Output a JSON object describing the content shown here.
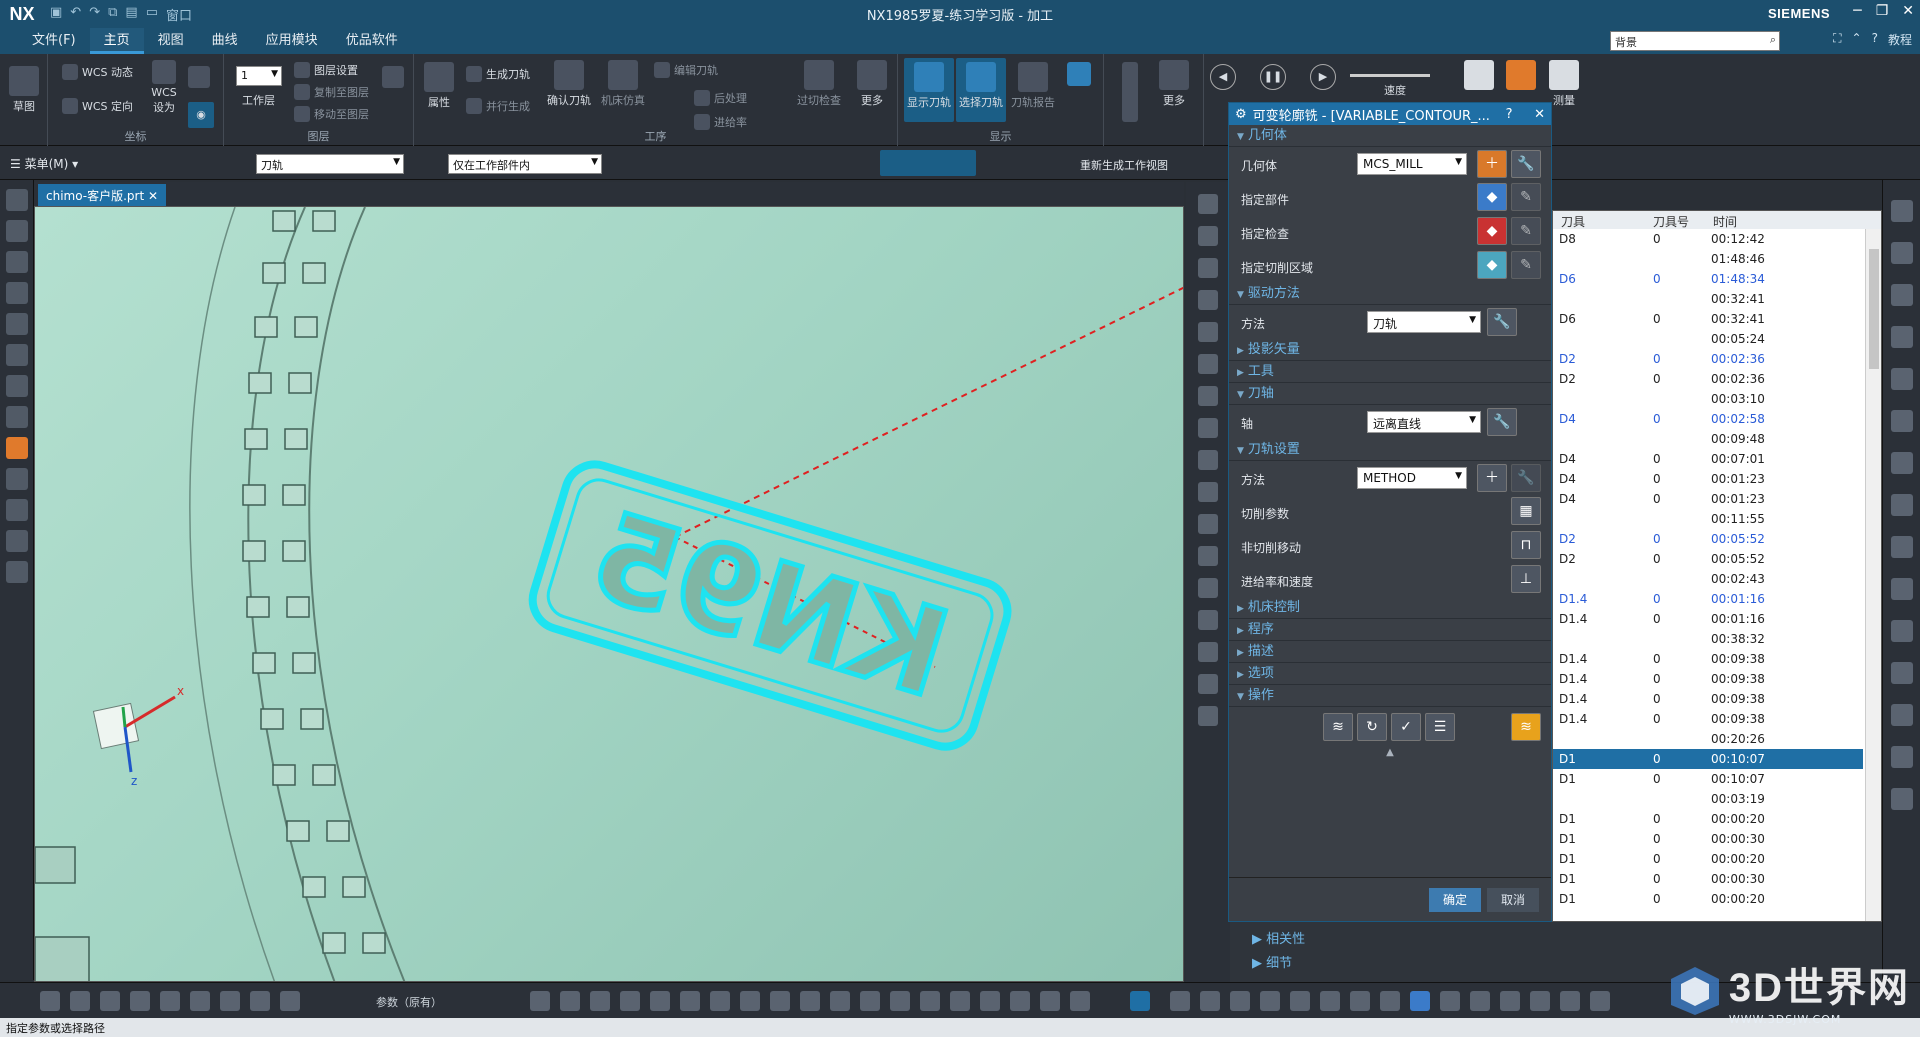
{
  "window": {
    "app_logo": "NX",
    "title": "NX1985罗夏-练习学习版 - 加工",
    "brand": "SIEMENS",
    "window_menu": "窗口"
  },
  "menu": {
    "items": [
      "文件(F)",
      "主页",
      "视图",
      "曲线",
      "应用模块",
      "优品软件"
    ],
    "active": "主页",
    "search_value": "背景",
    "help_label": "教程"
  },
  "ribbon": {
    "sketch": "草图",
    "wcs_dynamic": "WCS 动态",
    "wcs_orient": "WCS 定向",
    "wcs_set": "WCS 设为",
    "group_coord": "坐标",
    "work_layer_value": "1",
    "work_layer": "工作层",
    "layer_settings": "图层设置",
    "copy_to_layer": "复制至图层",
    "move_to_layer": "移动至图层",
    "group_layer": "图层",
    "attributes": "属性",
    "generate_path": "生成刀轨",
    "parallel_generate": "并行生成",
    "verify_path": "确认刀轨",
    "machine_sim": "机床仿真",
    "edit_path": "编辑刀轨",
    "post_process": "后处理",
    "feed_rate": "进给率",
    "overcut_check": "过切检查",
    "more": "更多",
    "group_operation": "工序",
    "show_path": "显示刀轨",
    "select_path": "选择刀轨",
    "path_report": "刀轨报告",
    "group_display": "显示",
    "more2": "更多",
    "speed": "速度",
    "measure": "测量"
  },
  "toolbar2": {
    "menu": "菜单(M)",
    "filter1": "刀轨",
    "filter2": "仅在工作部件内",
    "regen_view": "重新生成工作视图"
  },
  "viewport": {
    "file_tab": "chimo-客户版.prt",
    "engrave_text": "KN95",
    "axis_x": "x",
    "axis_z": "z"
  },
  "dialog": {
    "title": "可变轮廓铣 - [VARIABLE_CONTOUR_...",
    "sections": {
      "geometry": "几何体",
      "drive": "驱动方法",
      "projection": "投影矢量",
      "tool": "工具",
      "tool_axis": "刀轴",
      "path_settings": "刀轨设置",
      "machine_control": "机床控制",
      "program": "程序",
      "description": "描述",
      "options": "选项",
      "actions": "操作"
    },
    "geometry_label": "几何体",
    "geometry_value": "MCS_MILL",
    "specify_part": "指定部件",
    "specify_check": "指定检查",
    "specify_cut_area": "指定切削区域",
    "method_label": "方法",
    "drive_method_value": "刀轨",
    "axis_label": "轴",
    "axis_value": "远离直线",
    "path_method_label": "方法",
    "path_method_value": "METHOD",
    "cut_params": "切削参数",
    "non_cut_moves": "非切削移动",
    "feeds_speeds": "进给率和速度",
    "ok": "确定",
    "cancel": "取消"
  },
  "subpanel": {
    "relations": "相关性",
    "details": "细节"
  },
  "table": {
    "columns": [
      "刀具",
      "刀具号",
      "时间"
    ],
    "rows": [
      {
        "tool": "D8",
        "num": "0",
        "time": "00:12:42",
        "style": ""
      },
      {
        "tool": "",
        "num": "",
        "time": "01:48:46",
        "style": ""
      },
      {
        "tool": "D6",
        "num": "0",
        "time": "01:48:34",
        "style": "blue"
      },
      {
        "tool": "",
        "num": "",
        "time": "00:32:41",
        "style": ""
      },
      {
        "tool": "D6",
        "num": "0",
        "time": "00:32:41",
        "style": ""
      },
      {
        "tool": "",
        "num": "",
        "time": "00:05:24",
        "style": ""
      },
      {
        "tool": "D2",
        "num": "0",
        "time": "00:02:36",
        "style": "blue"
      },
      {
        "tool": "D2",
        "num": "0",
        "time": "00:02:36",
        "style": ""
      },
      {
        "tool": "",
        "num": "",
        "time": "00:03:10",
        "style": ""
      },
      {
        "tool": "D4",
        "num": "0",
        "time": "00:02:58",
        "style": "blue"
      },
      {
        "tool": "",
        "num": "",
        "time": "00:09:48",
        "style": ""
      },
      {
        "tool": "D4",
        "num": "0",
        "time": "00:07:01",
        "style": ""
      },
      {
        "tool": "D4",
        "num": "0",
        "time": "00:01:23",
        "style": ""
      },
      {
        "tool": "D4",
        "num": "0",
        "time": "00:01:23",
        "style": ""
      },
      {
        "tool": "",
        "num": "",
        "time": "00:11:55",
        "style": ""
      },
      {
        "tool": "D2",
        "num": "0",
        "time": "00:05:52",
        "style": "blue"
      },
      {
        "tool": "D2",
        "num": "0",
        "time": "00:05:52",
        "style": ""
      },
      {
        "tool": "",
        "num": "",
        "time": "00:02:43",
        "style": ""
      },
      {
        "tool": "D1.4",
        "num": "0",
        "time": "00:01:16",
        "style": "blue"
      },
      {
        "tool": "D1.4",
        "num": "0",
        "time": "00:01:16",
        "style": ""
      },
      {
        "tool": "",
        "num": "",
        "time": "00:38:32",
        "style": ""
      },
      {
        "tool": "D1.4",
        "num": "0",
        "time": "00:09:38",
        "style": ""
      },
      {
        "tool": "D1.4",
        "num": "0",
        "time": "00:09:38",
        "style": ""
      },
      {
        "tool": "D1.4",
        "num": "0",
        "time": "00:09:38",
        "style": ""
      },
      {
        "tool": "D1.4",
        "num": "0",
        "time": "00:09:38",
        "style": ""
      },
      {
        "tool": "",
        "num": "",
        "time": "00:20:26",
        "style": ""
      },
      {
        "tool": "D1",
        "num": "0",
        "time": "00:10:07",
        "style": "sel"
      },
      {
        "tool": "D1",
        "num": "0",
        "time": "00:10:07",
        "style": ""
      },
      {
        "tool": "",
        "num": "",
        "time": "00:03:19",
        "style": ""
      },
      {
        "tool": "D1",
        "num": "0",
        "time": "00:00:20",
        "style": ""
      },
      {
        "tool": "D1",
        "num": "0",
        "time": "00:00:30",
        "style": ""
      },
      {
        "tool": "D1",
        "num": "0",
        "time": "00:00:20",
        "style": ""
      },
      {
        "tool": "D1",
        "num": "0",
        "time": "00:00:30",
        "style": ""
      },
      {
        "tool": "D1",
        "num": "0",
        "time": "00:00:20",
        "style": ""
      }
    ]
  },
  "bottom": {
    "param_label": "参数（原有）",
    "status": "指定参数或选择路径"
  },
  "watermark": {
    "name": "3D世界网",
    "url": "WWW.3DSJW.COM"
  },
  "colors": {
    "title_bar": "#1c4f6e",
    "accent": "#1f6fa5",
    "section_text": "#6fb6e6",
    "toolpath": "#1ee3f0",
    "viewport": "#a8d8c8"
  }
}
